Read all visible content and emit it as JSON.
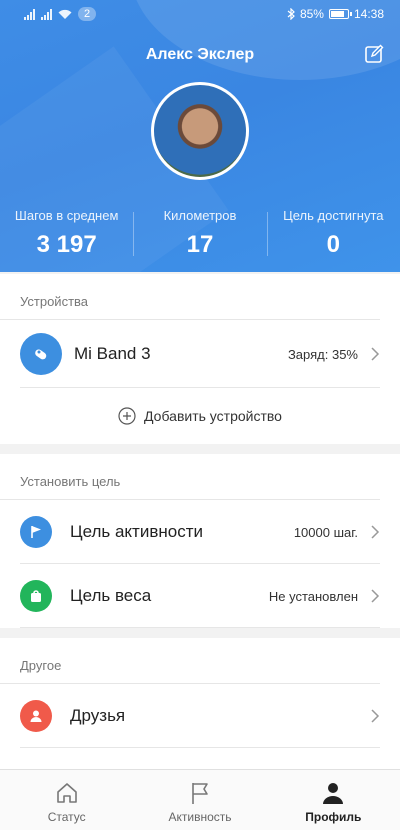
{
  "status_bar": {
    "notifications": "2",
    "battery": "85%",
    "time": "14:38"
  },
  "profile": {
    "name": "Алекс Экслер"
  },
  "stats": [
    {
      "label": "Шагов в среднем",
      "value": "3 197"
    },
    {
      "label": "Километров",
      "value": "17"
    },
    {
      "label": "Цель достигнута",
      "value": "0"
    }
  ],
  "devices": {
    "title": "Устройства",
    "device": {
      "name": "Mi Band 3",
      "battery": "Заряд: 35%"
    },
    "add_label": "Добавить устройство"
  },
  "goals": {
    "title": "Установить цель",
    "activity": {
      "label": "Цель активности",
      "value": "10000 шаг."
    },
    "weight": {
      "label": "Цель веса",
      "value": "Не установлен"
    }
  },
  "other": {
    "title": "Другое",
    "friends": {
      "label": "Друзья"
    }
  },
  "nav": [
    {
      "label": "Статус"
    },
    {
      "label": "Активность"
    },
    {
      "label": "Профиль"
    }
  ],
  "colors": {
    "header": "#3a86e2",
    "blue": "#3d8fe0",
    "green": "#22b55b",
    "red": "#f05a4a"
  }
}
